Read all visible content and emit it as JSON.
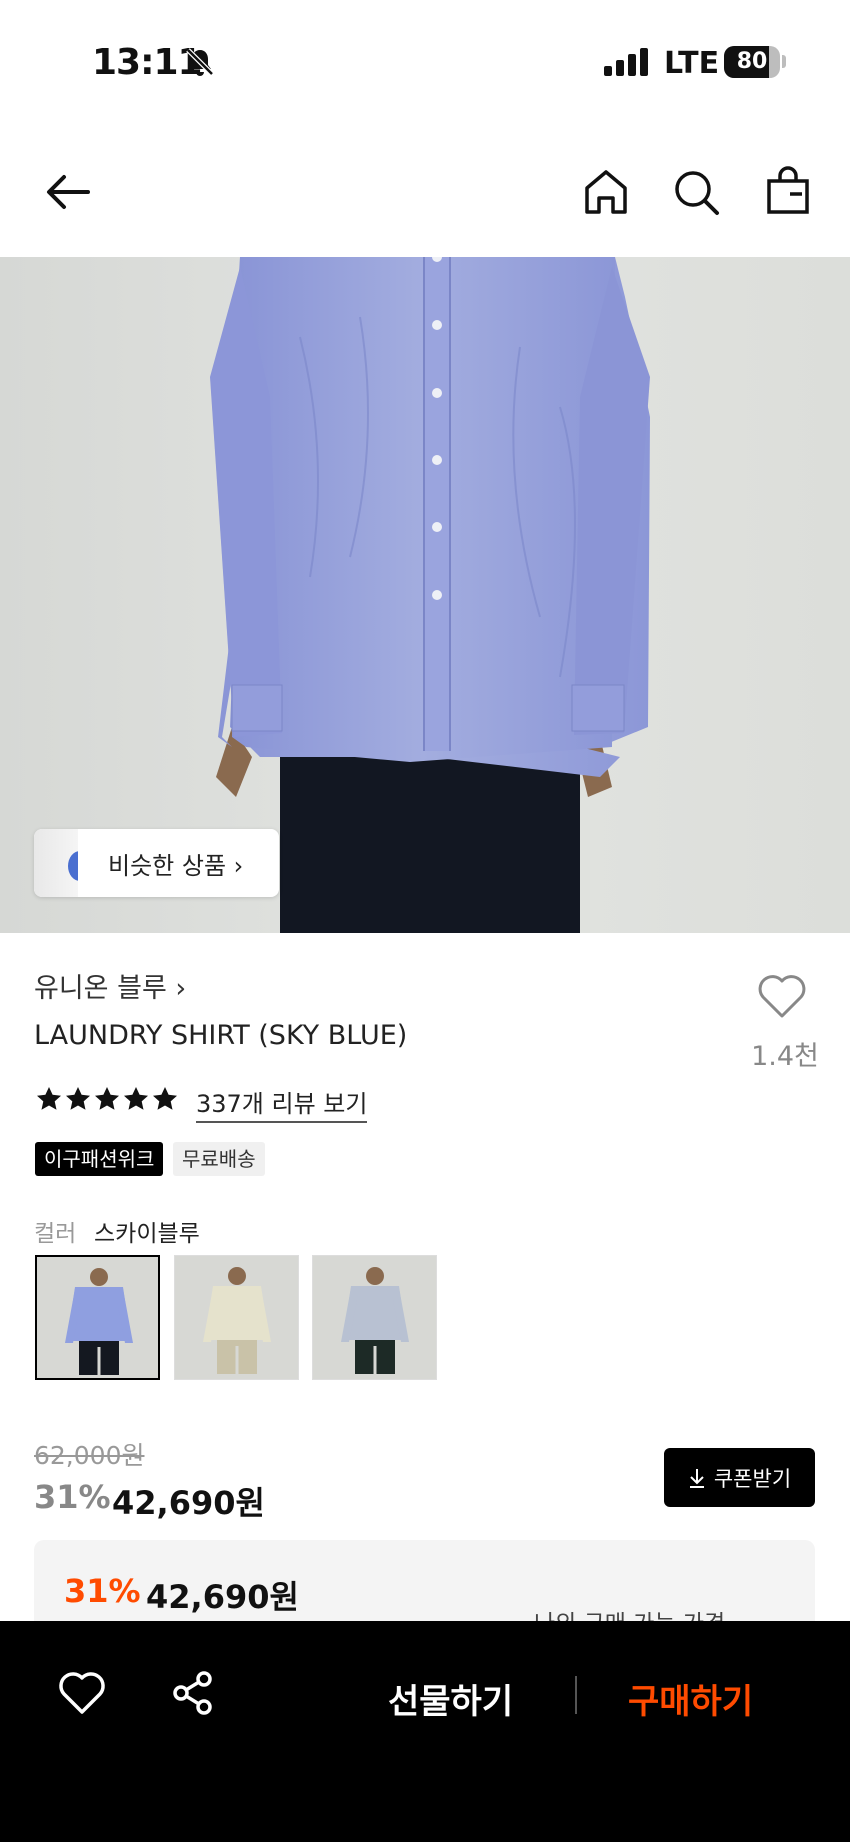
{
  "status_bar": {
    "time": "13:11",
    "network": "LTE",
    "battery": "80",
    "battery_level": 0.8
  },
  "nav": {
    "back_icon": "arrow-left-icon",
    "home_icon": "home-icon",
    "search_icon": "search-icon",
    "bag_icon": "shopping-bag-icon"
  },
  "hero": {
    "similar_label": "비슷한 상품 ›"
  },
  "product": {
    "brand": "유니온 블루 ›",
    "name": "LAUNDRY SHIRT (SKY BLUE)",
    "likes": "1.4천",
    "rating_stars": 5,
    "reviews": "337개 리뷰 보기",
    "badges": [
      "이구패션위크",
      "무료배송"
    ],
    "color_label": "컬러",
    "color_value": "스카이블루",
    "swatches": [
      {
        "color": "#8f9fe0",
        "pants": "#141820",
        "selected": true
      },
      {
        "color": "#e5e2cc",
        "pants": "#c9c2a8",
        "selected": false
      },
      {
        "color": "#b8c1d2",
        "pants": "#1d2a26",
        "selected": false
      }
    ]
  },
  "price": {
    "original": "62,000원",
    "discount": "31%",
    "final": "42,690원",
    "coupon_label": "쿠폰받기",
    "my_discount": "31%",
    "my_price": "42,690원",
    "my_label": "나의 구매 가능 가격"
  },
  "bottom_bar": {
    "gift": "선물하기",
    "buy": "구매하기"
  },
  "colors": {
    "accent": "#ff4b00",
    "shirt": "#97a3dd"
  }
}
